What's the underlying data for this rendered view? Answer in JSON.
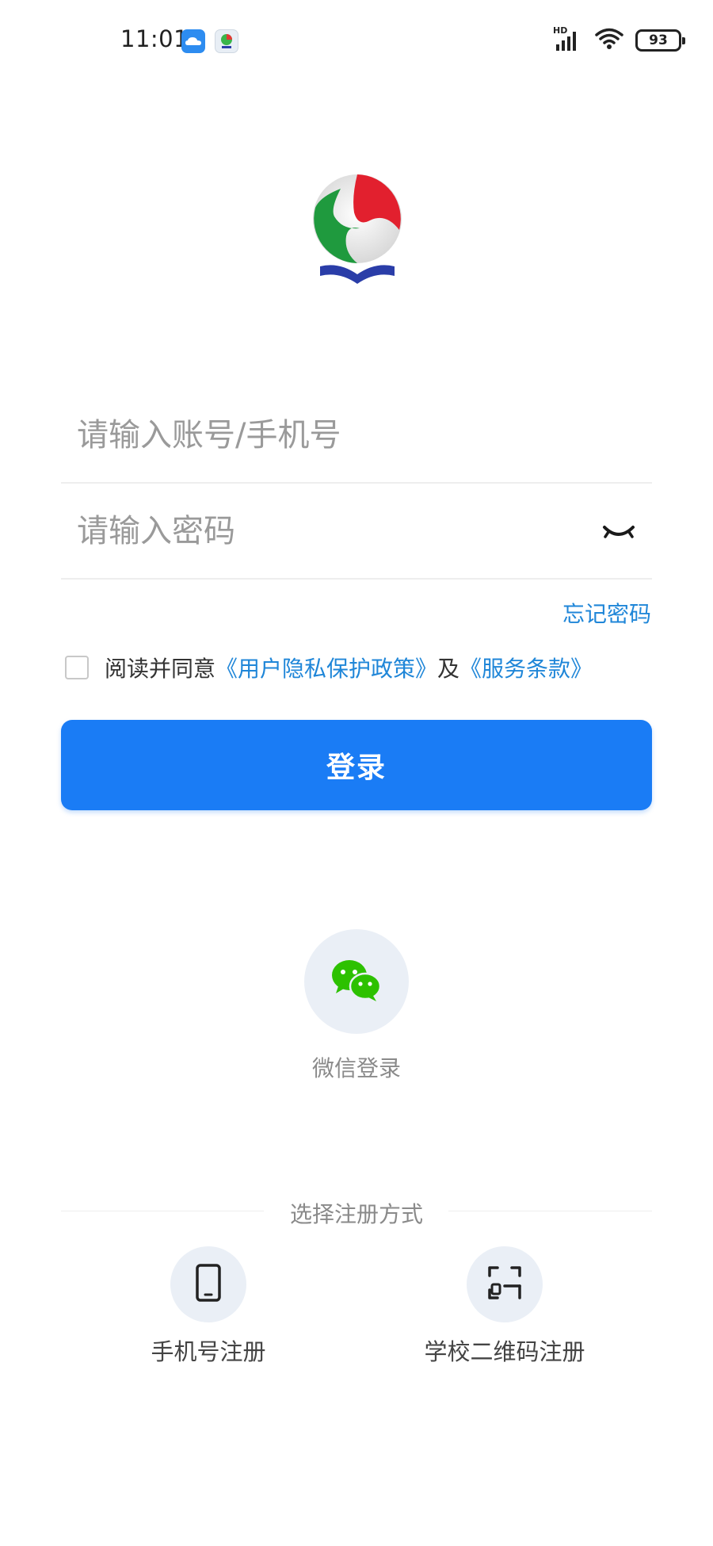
{
  "status_bar": {
    "time": "11:01",
    "network_label": "HD",
    "battery": "93",
    "icons": [
      "cloud-app-icon",
      "app-logo-small-icon",
      "signal-icon",
      "wifi-icon",
      "battery-icon"
    ]
  },
  "login": {
    "account_placeholder": "请输入账号/手机号",
    "password_placeholder": "请输入密码",
    "forgot_password": "忘记密码",
    "agree_prefix": "阅读并同意",
    "privacy_policy": "《用户隐私保护政策》",
    "agree_and": "及",
    "terms_of_service": "《服务条款》",
    "login_button": "登录"
  },
  "wechat": {
    "label": "微信登录"
  },
  "register": {
    "title": "选择注册方式",
    "phone_label": "手机号注册",
    "qr_label": "学校二维码注册"
  },
  "colors": {
    "primary": "#1a7cf5",
    "link": "#1f86d8",
    "wechat_green": "#2dc100",
    "icon_bg": "#eaeff6"
  }
}
